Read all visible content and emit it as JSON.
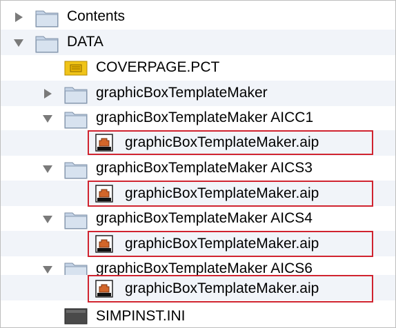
{
  "tree": {
    "items": [
      {
        "label": "Contents",
        "kind": "folder",
        "expanded": false,
        "level": 0
      },
      {
        "label": "DATA",
        "kind": "folder",
        "expanded": true,
        "level": 0
      },
      {
        "label": "COVERPAGE.PCT",
        "kind": "pct-file",
        "level": 2
      },
      {
        "label": "graphicBoxTemplateMaker",
        "kind": "folder",
        "expanded": false,
        "level": 1
      },
      {
        "label": "graphicBoxTemplateMaker AICC1",
        "kind": "folder",
        "expanded": true,
        "level": 1
      },
      {
        "label": "graphicBoxTemplateMaker.aip",
        "kind": "aip-file",
        "highlighted": true,
        "level": 2
      },
      {
        "label": "graphicBoxTemplateMaker AICS3",
        "kind": "folder",
        "expanded": true,
        "level": 1
      },
      {
        "label": "graphicBoxTemplateMaker.aip",
        "kind": "aip-file",
        "highlighted": true,
        "level": 2
      },
      {
        "label": "graphicBoxTemplateMaker AICS4",
        "kind": "folder",
        "expanded": true,
        "level": 1
      },
      {
        "label": "graphicBoxTemplateMaker.aip",
        "kind": "aip-file",
        "highlighted": true,
        "level": 2
      },
      {
        "label": "graphicBoxTemplateMaker AICS6",
        "kind": "folder",
        "expanded": true,
        "level": 1
      },
      {
        "label": "graphicBoxTemplateMaker.aip",
        "kind": "aip-file",
        "highlighted": true,
        "level": 2
      },
      {
        "label": "SIMPINST.INI",
        "kind": "ini-file",
        "level": 2
      }
    ]
  },
  "colors": {
    "highlight_border": "#d0232f",
    "alt_row": "#f1f4f9",
    "folder_fill": "#c9d6e6"
  }
}
